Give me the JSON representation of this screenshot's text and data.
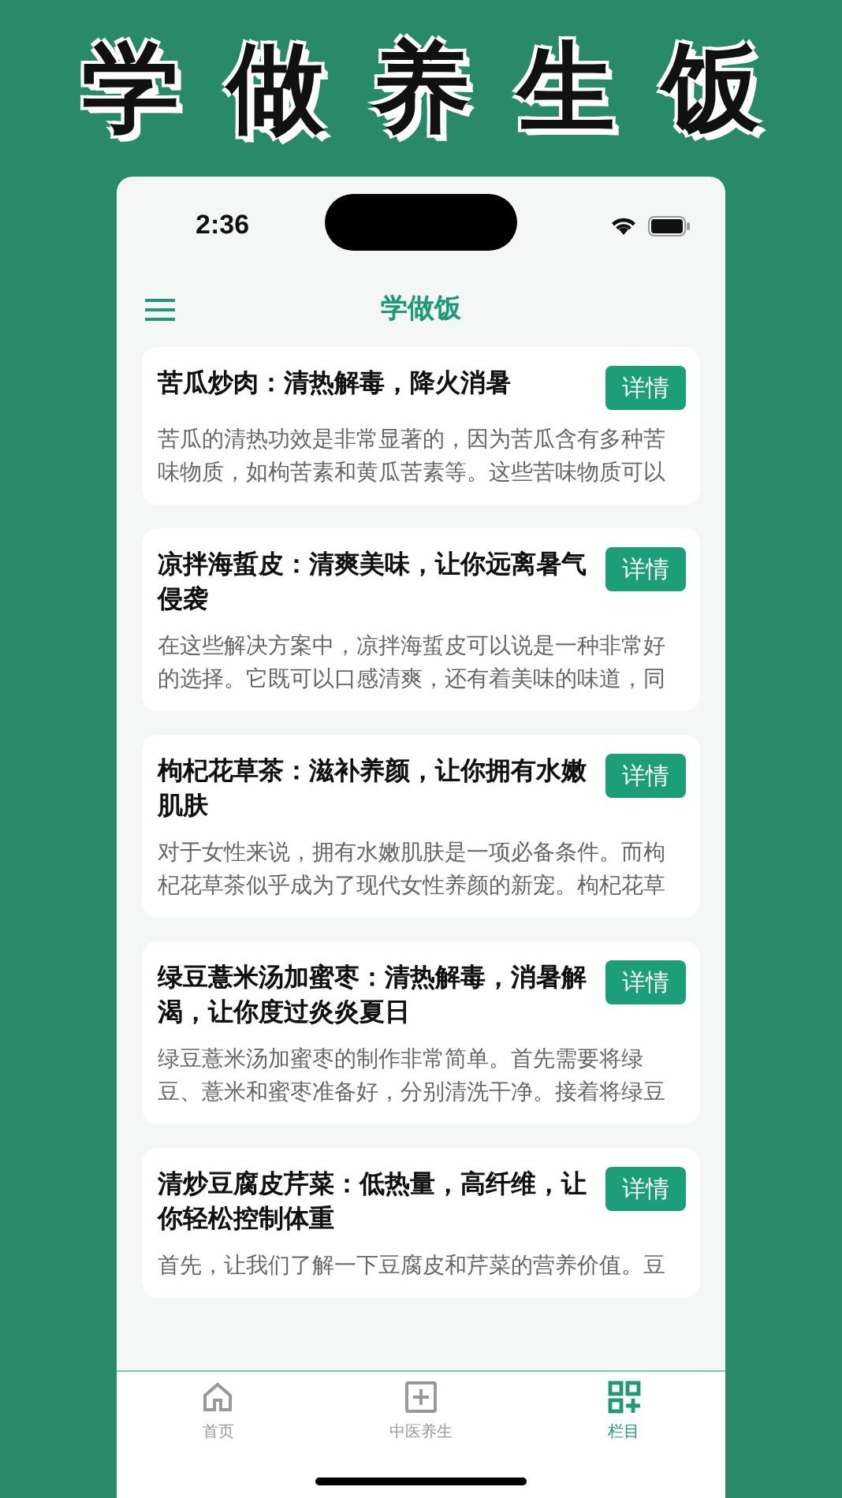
{
  "banner_title": "学做养生饭",
  "status_bar": {
    "time": "2:36"
  },
  "header": {
    "title": "学做饭"
  },
  "articles": [
    {
      "title": "苦瓜炒肉：清热解毒，降火消暑",
      "button": "详情",
      "excerpt": "苦瓜的清热功效是非常显著的，因为苦瓜含有多种苦味物质，如枸苦素和黄瓜苦素等。这些苦味物质可以"
    },
    {
      "title": "凉拌海蜇皮：清爽美味，让你远离暑气侵袭",
      "button": "详情",
      "excerpt": "在这些解决方案中，凉拌海蜇皮可以说是一种非常好的选择。它既可以口感清爽，还有着美味的味道，同"
    },
    {
      "title": "枸杞花草茶：滋补养颜，让你拥有水嫩肌肤",
      "button": "详情",
      "excerpt": "对于女性来说，拥有水嫩肌肤是一项必备条件。而枸杞花草茶似乎成为了现代女性养颜的新宠。枸杞花草"
    },
    {
      "title": "绿豆薏米汤加蜜枣：清热解毒，消暑解渴，让你度过炎炎夏日",
      "button": "详情",
      "excerpt": "绿豆薏米汤加蜜枣的制作非常简单。首先需要将绿豆、薏米和蜜枣准备好，分别清洗干净。接着将绿豆"
    },
    {
      "title": "清炒豆腐皮芹菜：低热量，高纤维，让你轻松控制体重",
      "button": "详情",
      "excerpt": "首先，让我们了解一下豆腐皮和芹菜的营养价值。豆"
    }
  ],
  "tabs": [
    {
      "kind": "home",
      "label": "首页",
      "selected": false
    },
    {
      "kind": "plus",
      "label": "中医养生",
      "selected": false
    },
    {
      "kind": "grid",
      "label": "栏目",
      "selected": true
    }
  ]
}
